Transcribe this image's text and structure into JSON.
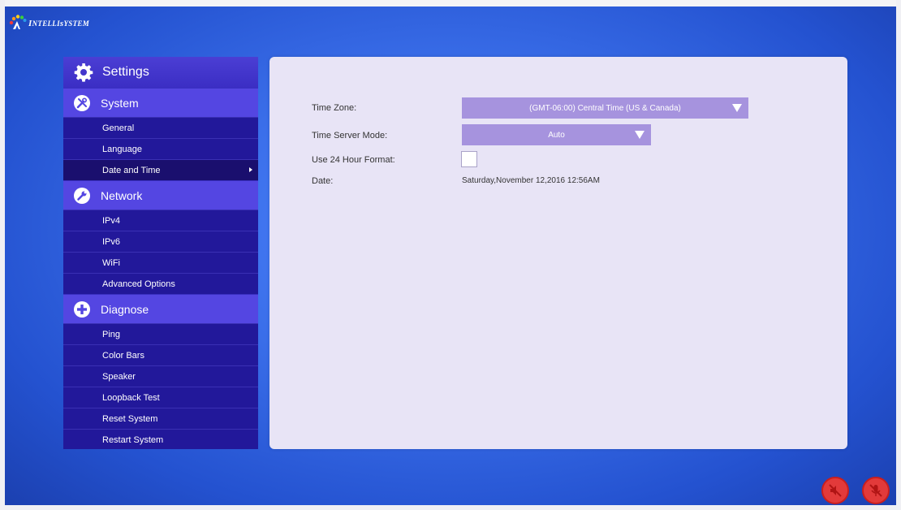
{
  "brand": {
    "name": "Intellisystem"
  },
  "sidebar": {
    "header": {
      "label": "Settings",
      "icon": "gear-icon"
    },
    "sections": [
      {
        "label": "System",
        "icon": "tools-icon",
        "items": [
          {
            "label": "General"
          },
          {
            "label": "Language"
          },
          {
            "label": "Date and Time",
            "active": true
          }
        ]
      },
      {
        "label": "Network",
        "icon": "wrench-icon",
        "items": [
          {
            "label": "IPv4"
          },
          {
            "label": "IPv6"
          },
          {
            "label": "WiFi"
          },
          {
            "label": "Advanced Options"
          }
        ]
      },
      {
        "label": "Diagnose",
        "icon": "plus-circle-icon",
        "items": [
          {
            "label": "Ping"
          },
          {
            "label": "Color Bars"
          },
          {
            "label": "Speaker"
          },
          {
            "label": "Loopback Test"
          },
          {
            "label": "Reset System"
          },
          {
            "label": "Restart System"
          }
        ]
      }
    ]
  },
  "form": {
    "time_zone": {
      "label": "Time Zone:",
      "value": "(GMT-06:00) Central Time (US & Canada)"
    },
    "time_server_mode": {
      "label": "Time Server Mode:",
      "value": "Auto"
    },
    "use_24_hour": {
      "label": "Use 24 Hour Format:",
      "checked": false
    },
    "date": {
      "label": "Date:",
      "value": "Saturday,November 12,2016 12:56AM"
    }
  },
  "status_icons": [
    {
      "name": "speaker-muted-icon"
    },
    {
      "name": "mic-muted-icon"
    }
  ],
  "colors": {
    "background": "#3a6ee9",
    "sidebar": "#22189a",
    "section": "#5446e2",
    "dropdown": "#a693de",
    "panel": "#e8e4f6",
    "mute": "#e23a3a"
  }
}
